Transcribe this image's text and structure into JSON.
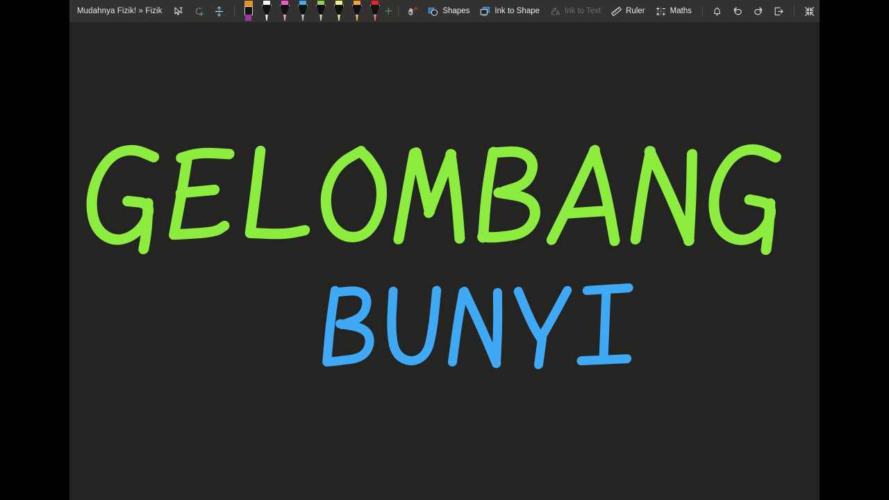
{
  "window": {
    "background_color": "#000000",
    "canvas_color": "#242422",
    "toolbar_color": "#333231"
  },
  "toolbar": {
    "title": "Mudahnya Fizik! » Fizik",
    "tools": [
      {
        "name": "select-object-tool",
        "icon": "cursor-text-select-icon",
        "label": ""
      },
      {
        "name": "lasso-select-tool",
        "icon": "lasso-add-icon",
        "label": ""
      },
      {
        "name": "insert-space-tool",
        "icon": "insert-space-arrows-icon",
        "label": ""
      }
    ],
    "pens": [
      {
        "name": "highlighter-purple",
        "type": "highlighter",
        "cap_color": "#e59420",
        "tip_color": "#a0369f",
        "selected": false
      },
      {
        "name": "pen-white",
        "type": "pen",
        "cap_color": "#f2f2f2",
        "tip_color": "#f2f2f2",
        "selected": false
      },
      {
        "name": "pen-pink",
        "type": "pen",
        "cap_color": "#ef5bc6",
        "tip_color": "#efa5c9",
        "selected": false
      },
      {
        "name": "pen-blue",
        "type": "pen",
        "cap_color": "#4aa8ef",
        "tip_color": "#9cc9ea",
        "selected": false
      },
      {
        "name": "pen-green",
        "type": "pen",
        "cap_color": "#8fd44a",
        "tip_color": "#bedd92",
        "selected": false
      },
      {
        "name": "pen-yellow",
        "type": "pen",
        "cap_color": "#f3f07a",
        "tip_color": "#f3efa8",
        "selected": false
      },
      {
        "name": "pen-orange",
        "type": "pen",
        "cap_color": "#f5a61c",
        "tip_color": "#f5b954",
        "selected": false
      },
      {
        "name": "pen-red",
        "type": "pen",
        "cap_color": "#e5222a",
        "tip_color": "#ef7077",
        "selected": false
      }
    ],
    "add_pen_label": "+",
    "buttons": [
      {
        "name": "replay-ink-button",
        "label": "",
        "icon": "ink-replay-icon",
        "disabled": false
      },
      {
        "name": "shapes-button",
        "label": "Shapes",
        "icon": "shapes-icon",
        "disabled": false
      },
      {
        "name": "ink-to-shape-button",
        "label": "Ink to Shape",
        "icon": "ink-to-shape-icon",
        "disabled": false
      },
      {
        "name": "ink-to-text-button",
        "label": "Ink to Text",
        "icon": "ink-to-text-icon",
        "disabled": true
      },
      {
        "name": "ruler-button",
        "label": "Ruler",
        "icon": "ruler-icon",
        "disabled": false
      },
      {
        "name": "maths-button",
        "label": "Maths",
        "icon": "maths-icon",
        "disabled": false
      }
    ],
    "right_buttons": [
      {
        "name": "notifications-button",
        "icon": "bell-icon"
      },
      {
        "name": "undo-button",
        "icon": "undo-arrow-icon"
      },
      {
        "name": "redo-button",
        "icon": "redo-arrow-icon"
      },
      {
        "name": "share-button",
        "icon": "share-export-icon"
      },
      {
        "name": "collapse-ribbon-button",
        "icon": "collapse-arrows-icon"
      }
    ]
  },
  "canvas": {
    "ink_strokes": [
      {
        "name": "title-line-1",
        "text": "GELOMBANG",
        "color": "#8ced3f"
      },
      {
        "name": "title-line-2",
        "text": "BUNYI",
        "color": "#3fa9f5"
      }
    ]
  }
}
